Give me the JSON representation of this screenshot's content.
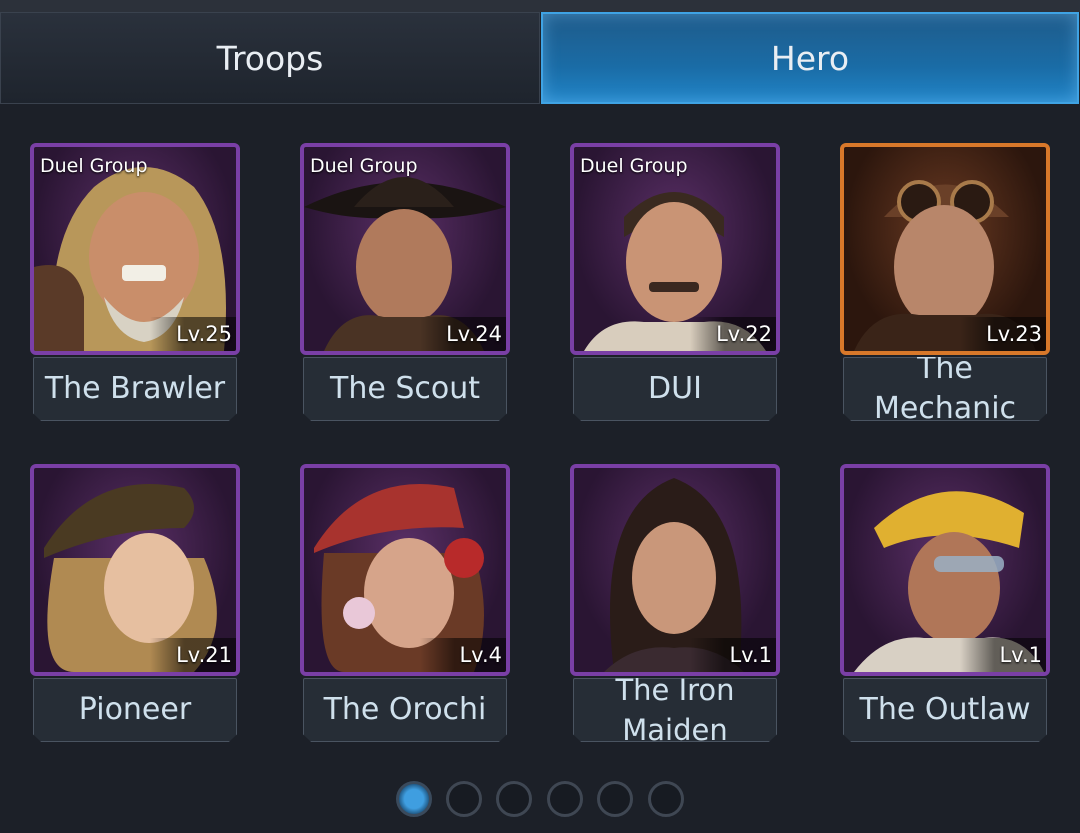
{
  "tabs": [
    {
      "label": "Troops",
      "active": false
    },
    {
      "label": "Hero",
      "active": true
    }
  ],
  "heroes": [
    {
      "name": "The Brawler",
      "level": "Lv.25",
      "badge": "Duel Group",
      "rarity": "purple"
    },
    {
      "name": "The Scout",
      "level": "Lv.24",
      "badge": "Duel Group",
      "rarity": "purple"
    },
    {
      "name": "DUI",
      "level": "Lv.22",
      "badge": "Duel Group",
      "rarity": "purple"
    },
    {
      "name": "The Mechanic",
      "level": "Lv.23",
      "badge": "",
      "rarity": "orange"
    },
    {
      "name": "Pioneer",
      "level": "Lv.21",
      "badge": "",
      "rarity": "purple"
    },
    {
      "name": "The Orochi",
      "level": "Lv.4",
      "badge": "",
      "rarity": "purple"
    },
    {
      "name": "The Iron Maiden",
      "level": "Lv.1",
      "badge": "",
      "rarity": "purple"
    },
    {
      "name": "The Outlaw",
      "level": "Lv.1",
      "badge": "",
      "rarity": "purple"
    }
  ],
  "pagination": {
    "pages": 6,
    "current": 1
  },
  "colors": {
    "accent": "#2184c7",
    "purple_frame": "#7a3fa6",
    "orange_frame": "#d8782a"
  }
}
